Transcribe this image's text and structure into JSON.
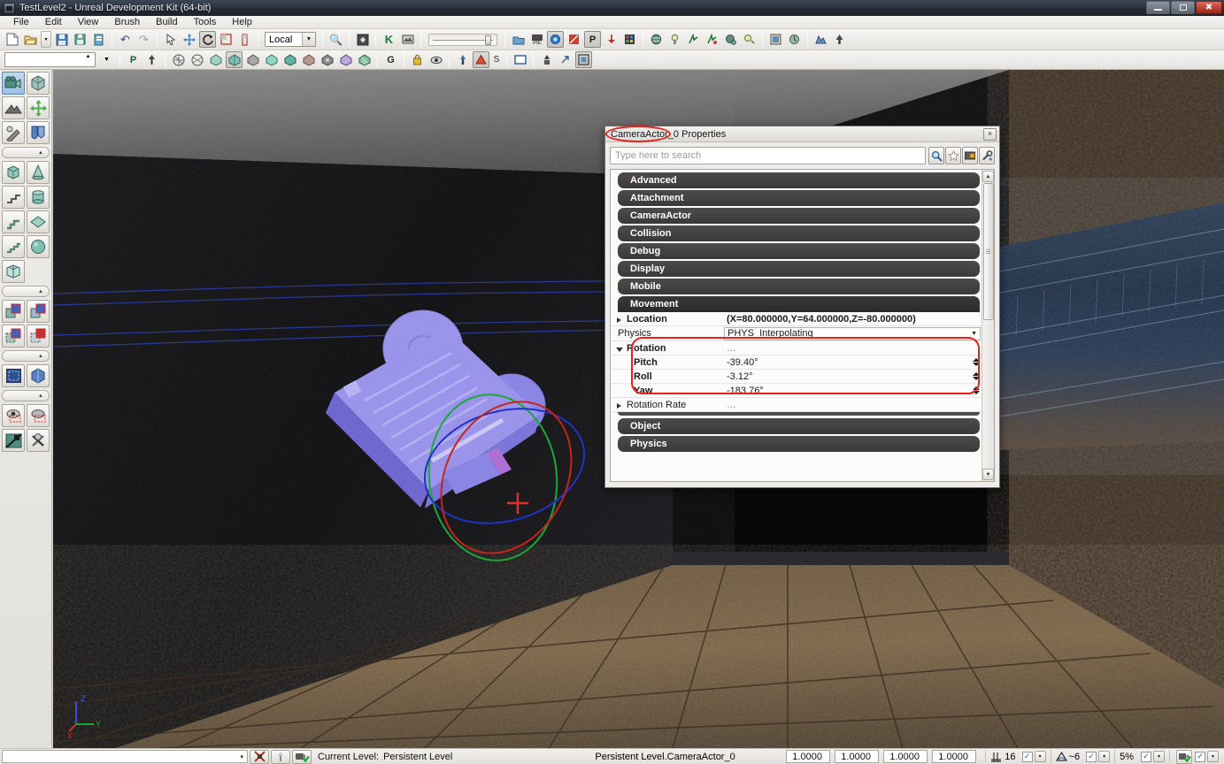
{
  "window": {
    "title": "TestLevel2 - Unreal Development Kit (64-bit)",
    "icon": "udk-app-icon",
    "controls": {
      "minimize": "minimize-icon",
      "maximize": "maximize-icon",
      "close": "close-icon"
    }
  },
  "menubar": {
    "items": [
      {
        "label": "File"
      },
      {
        "label": "Edit"
      },
      {
        "label": "View"
      },
      {
        "label": "Brush"
      },
      {
        "label": "Build"
      },
      {
        "label": "Tools"
      },
      {
        "label": "Help"
      }
    ]
  },
  "toolbar_main": {
    "transform_space": "Local",
    "buttons": [
      {
        "name": "new-file-icon",
        "glyph": "📄"
      },
      {
        "name": "open-file-icon",
        "glyph": "📂"
      },
      {
        "name": "open-recent-dropdown-icon",
        "glyph": "▾"
      },
      {
        "name": "save-icon",
        "glyph": "💾"
      },
      {
        "name": "save-all-icon",
        "glyph": "💾"
      },
      {
        "name": "save-as-icon",
        "glyph": "📋"
      },
      {
        "name": "undo-icon",
        "glyph": "↶"
      },
      {
        "name": "redo-icon",
        "glyph": "↷"
      },
      {
        "name": "select-tool-icon",
        "glyph": "➤"
      },
      {
        "name": "translate-tool-icon",
        "glyph": "✥"
      },
      {
        "name": "rotate-tool-icon",
        "glyph": "↻"
      },
      {
        "name": "scale-tool-icon",
        "glyph": "◰"
      },
      {
        "name": "non-uniform-scale-tool-icon",
        "glyph": "↕"
      },
      {
        "name": "search-actors-icon",
        "glyph": "🔎"
      },
      {
        "name": "content-browser-icon",
        "glyph": "▣"
      },
      {
        "name": "kismet-editor-icon",
        "glyph": "K"
      },
      {
        "name": "matinee-editor-icon",
        "glyph": "▤"
      },
      {
        "name": "play-in-editor-icon",
        "glyph": "▶"
      },
      {
        "name": "play-on-pc-icon",
        "glyph": "PIE"
      },
      {
        "name": "lighting-build-icon",
        "glyph": "☀"
      },
      {
        "name": "geometry-build-icon",
        "glyph": "◥"
      },
      {
        "name": "path-build-icon",
        "glyph": "P"
      },
      {
        "name": "build-all-icon",
        "glyph": "⚒"
      },
      {
        "name": "stats-icon",
        "glyph": "▦"
      },
      {
        "name": "world-properties-icon",
        "glyph": "●"
      },
      {
        "name": "light-actor-icon",
        "glyph": "✶"
      },
      {
        "name": "bsp-tool-icon",
        "glyph": "➦"
      },
      {
        "name": "mesh-paint-icon",
        "glyph": "✎"
      },
      {
        "name": "volumes-icon",
        "glyph": "◈"
      },
      {
        "name": "lightmass-icon",
        "glyph": "☀"
      },
      {
        "name": "viewport-config-icon",
        "glyph": "▣"
      },
      {
        "name": "realtime-preview-icon",
        "glyph": "◔"
      },
      {
        "name": "terrain-editor-icon",
        "glyph": "⛰"
      },
      {
        "name": "foliage-tool-icon",
        "glyph": "☘"
      }
    ]
  },
  "toolbar_brush": {
    "buttons": [
      {
        "name": "brush-dropdown-icon",
        "glyph": "▾"
      },
      {
        "name": "brush-paths-icon",
        "glyph": "P"
      },
      {
        "name": "brush-pivot-icon",
        "glyph": "⚓"
      },
      {
        "name": "brush-wireframe-icon",
        "glyph": "⬡"
      },
      {
        "name": "brush-brushwire-icon",
        "glyph": "⬡"
      },
      {
        "name": "brush-unlit-icon",
        "glyph": "⬟"
      },
      {
        "name": "brush-lit-icon",
        "glyph": "⬟"
      },
      {
        "name": "brush-detail-lighting-icon",
        "glyph": "⬟"
      },
      {
        "name": "brush-lighting-only-icon",
        "glyph": "⬟"
      },
      {
        "name": "brush-light-complexity-icon",
        "glyph": "⬟"
      },
      {
        "name": "brush-texture-density-icon",
        "glyph": "⬟"
      },
      {
        "name": "brush-shader-complexity-icon",
        "glyph": "⬟"
      },
      {
        "name": "brush-lightmap-density-icon",
        "glyph": "⬟"
      },
      {
        "name": "brush-reflections-icon",
        "glyph": "⬟"
      },
      {
        "name": "game-view-icon",
        "glyph": "G"
      },
      {
        "name": "lock-viewport-icon",
        "glyph": "🔒"
      },
      {
        "name": "show-flags-icon",
        "glyph": "👁"
      },
      {
        "name": "actor-placement-icon",
        "glyph": "♟"
      },
      {
        "name": "lighting-preview-icon",
        "glyph": "▲"
      },
      {
        "name": "streaming-levels-icon",
        "glyph": "S"
      },
      {
        "name": "maximize-viewport-icon",
        "glyph": "▢"
      },
      {
        "name": "camera-speed-icon",
        "glyph": "♟"
      },
      {
        "name": "detach-viewport-icon",
        "glyph": "↗"
      },
      {
        "name": "viewport-layout-icon",
        "glyph": "▣"
      }
    ]
  },
  "sidebar": {
    "groups": [
      {
        "name": "modes",
        "buttons": [
          {
            "name": "camera-mode-icon",
            "glyph": "🎥",
            "selected": true
          },
          {
            "name": "geometry-mode-icon",
            "glyph": "⬢",
            "selected": false
          },
          {
            "name": "terrain-mode-icon",
            "glyph": "⛰",
            "selected": false
          },
          {
            "name": "move-mode-icon",
            "glyph": "✥",
            "selected": false
          },
          {
            "name": "texture-mode-icon",
            "glyph": "✒",
            "selected": false
          },
          {
            "name": "mesh-paint-mode-icon",
            "glyph": "◠",
            "selected": false
          }
        ]
      },
      {
        "name": "brush-primitives",
        "buttons": [
          {
            "name": "cube-brush-icon",
            "glyph": "⬟",
            "selected": false
          },
          {
            "name": "cone-brush-icon",
            "glyph": "▲",
            "selected": false
          },
          {
            "name": "curved-stair-brush-icon",
            "glyph": "◤",
            "selected": false
          },
          {
            "name": "cylinder-brush-icon",
            "glyph": "⛃",
            "selected": false
          },
          {
            "name": "linear-stair-brush-icon",
            "glyph": "◤",
            "selected": false
          },
          {
            "name": "sheet-brush-icon",
            "glyph": "◇",
            "selected": false
          },
          {
            "name": "spiral-stair-brush-icon",
            "glyph": "◤",
            "selected": false
          },
          {
            "name": "sphere-brush-icon",
            "glyph": "●",
            "selected": false
          },
          {
            "name": "volumetric-brush-icon",
            "glyph": "❖",
            "selected": false
          }
        ]
      },
      {
        "name": "csg-operations",
        "buttons": [
          {
            "name": "csg-add-icon",
            "glyph": "◰",
            "selected": false
          },
          {
            "name": "csg-subtract-icon",
            "glyph": "◱",
            "selected": false
          },
          {
            "name": "csg-intersect-icon",
            "glyph": "◲",
            "selected": false
          },
          {
            "name": "csg-deintersect-icon",
            "glyph": "◳",
            "selected": false
          }
        ]
      },
      {
        "name": "volumes",
        "buttons": [
          {
            "name": "add-volume-icon",
            "glyph": "▣",
            "selected": false
          },
          {
            "name": "add-special-brush-icon",
            "glyph": "⬢",
            "selected": false
          }
        ]
      },
      {
        "name": "selection-visibility",
        "buttons": [
          {
            "name": "show-selected-icon",
            "glyph": "👁",
            "selected": false
          },
          {
            "name": "hide-selected-icon",
            "glyph": "○",
            "selected": false
          },
          {
            "name": "invert-selection-icon",
            "glyph": "◧",
            "selected": false
          },
          {
            "name": "clear-selection-icon",
            "glyph": "✖",
            "selected": false
          }
        ]
      }
    ]
  },
  "viewport": {
    "axis_labels": {
      "z": "Z",
      "x": "X",
      "y": "Y"
    },
    "selected_actor": "CameraActor_0"
  },
  "dialog": {
    "title_prefix": "CameraActor_0",
    "title_suffix": " Properties",
    "title_full": "CameraActor_0 Properties",
    "close_label": "×",
    "search": {
      "placeholder": "Type here to search",
      "value": "",
      "buttons": [
        {
          "name": "search-submit-icon",
          "glyph": "🔎"
        },
        {
          "name": "favorites-icon",
          "glyph": "☆"
        },
        {
          "name": "show-categories-icon",
          "glyph": "🗂"
        },
        {
          "name": "property-options-icon",
          "glyph": "🔧"
        }
      ]
    },
    "categories": [
      {
        "label": "Advanced",
        "expanded": false
      },
      {
        "label": "Attachment",
        "expanded": false
      },
      {
        "label": "CameraActor",
        "expanded": false
      },
      {
        "label": "Collision",
        "expanded": false
      },
      {
        "label": "Debug",
        "expanded": false
      },
      {
        "label": "Display",
        "expanded": false
      },
      {
        "label": "Mobile",
        "expanded": false
      },
      {
        "label": "Movement",
        "expanded": true
      },
      {
        "label": "Object",
        "expanded": false
      },
      {
        "label": "Physics",
        "expanded": false
      }
    ],
    "movement_rows": [
      {
        "name": "location",
        "label": "Location",
        "value": "(X=80.000000,Y=64.000000,Z=-80.000000)",
        "kind": "expandable",
        "expanded": false,
        "bold": true
      },
      {
        "name": "physics",
        "label": "Physics",
        "value": "PHYS_Interpolating",
        "kind": "dropdown",
        "bold": false
      },
      {
        "name": "rotation",
        "label": "Rotation",
        "value": "…",
        "kind": "expandable",
        "expanded": true,
        "bold": true,
        "highlighted": true
      },
      {
        "name": "rotation-pitch",
        "label": "Pitch",
        "value": "-39.40°",
        "kind": "spinner",
        "bold": true,
        "indent": true
      },
      {
        "name": "rotation-roll",
        "label": "Roll",
        "value": "-3.12°",
        "kind": "spinner",
        "bold": true,
        "indent": true
      },
      {
        "name": "rotation-yaw",
        "label": "Yaw",
        "value": "-183.76°",
        "kind": "spinner",
        "bold": true,
        "indent": true
      },
      {
        "name": "rotation-rate",
        "label": "Rotation Rate",
        "value": "…",
        "kind": "expandable",
        "expanded": false,
        "bold": false
      }
    ],
    "scroll": {
      "up_glyph": "▲",
      "down_glyph": "▼",
      "grip_glyph": "≡"
    }
  },
  "statusbar": {
    "command_value": "",
    "command_arrow": "▾",
    "buttons": [
      {
        "name": "cancel-build-icon",
        "glyph": "✖"
      },
      {
        "name": "lighting-status-icon",
        "glyph": "☲"
      },
      {
        "name": "paths-status-icon",
        "glyph": "✔"
      }
    ],
    "current_level_label": "Current Level:",
    "current_level_value": "Persistent Level",
    "selection_label": "Persistent Level.CameraActor_0",
    "drag_grid_fields": [
      "1.0000",
      "1.0000",
      "1.0000",
      "1.0000"
    ],
    "grid_snap": {
      "icon": "grid-snap-icon",
      "value": "16",
      "checked": true,
      "check_glyph": "✓",
      "drop_glyph": "▾"
    },
    "rotation_snap": {
      "icon": "rotation-snap-icon",
      "value": "~6",
      "checked": true,
      "check_glyph": "✓",
      "drop_glyph": "▾"
    },
    "scale_snap": {
      "icon": "scale-snap-icon",
      "value": "5%",
      "checked": true,
      "check_glyph": "✓",
      "drop_glyph": "▾"
    },
    "camera_speed": {
      "icon": "camera-speed-icon",
      "checked": true,
      "check_glyph": "✓",
      "drop_glyph": "▾"
    }
  },
  "colors": {
    "accent_red": "#e8211c",
    "category_bg": "#413f3d",
    "titlebar": "#2c343e",
    "actor_purple": "#8b86e0",
    "gizmo_red": "#d03028",
    "gizmo_green": "#22aa33",
    "gizmo_blue": "#2a44cc"
  }
}
